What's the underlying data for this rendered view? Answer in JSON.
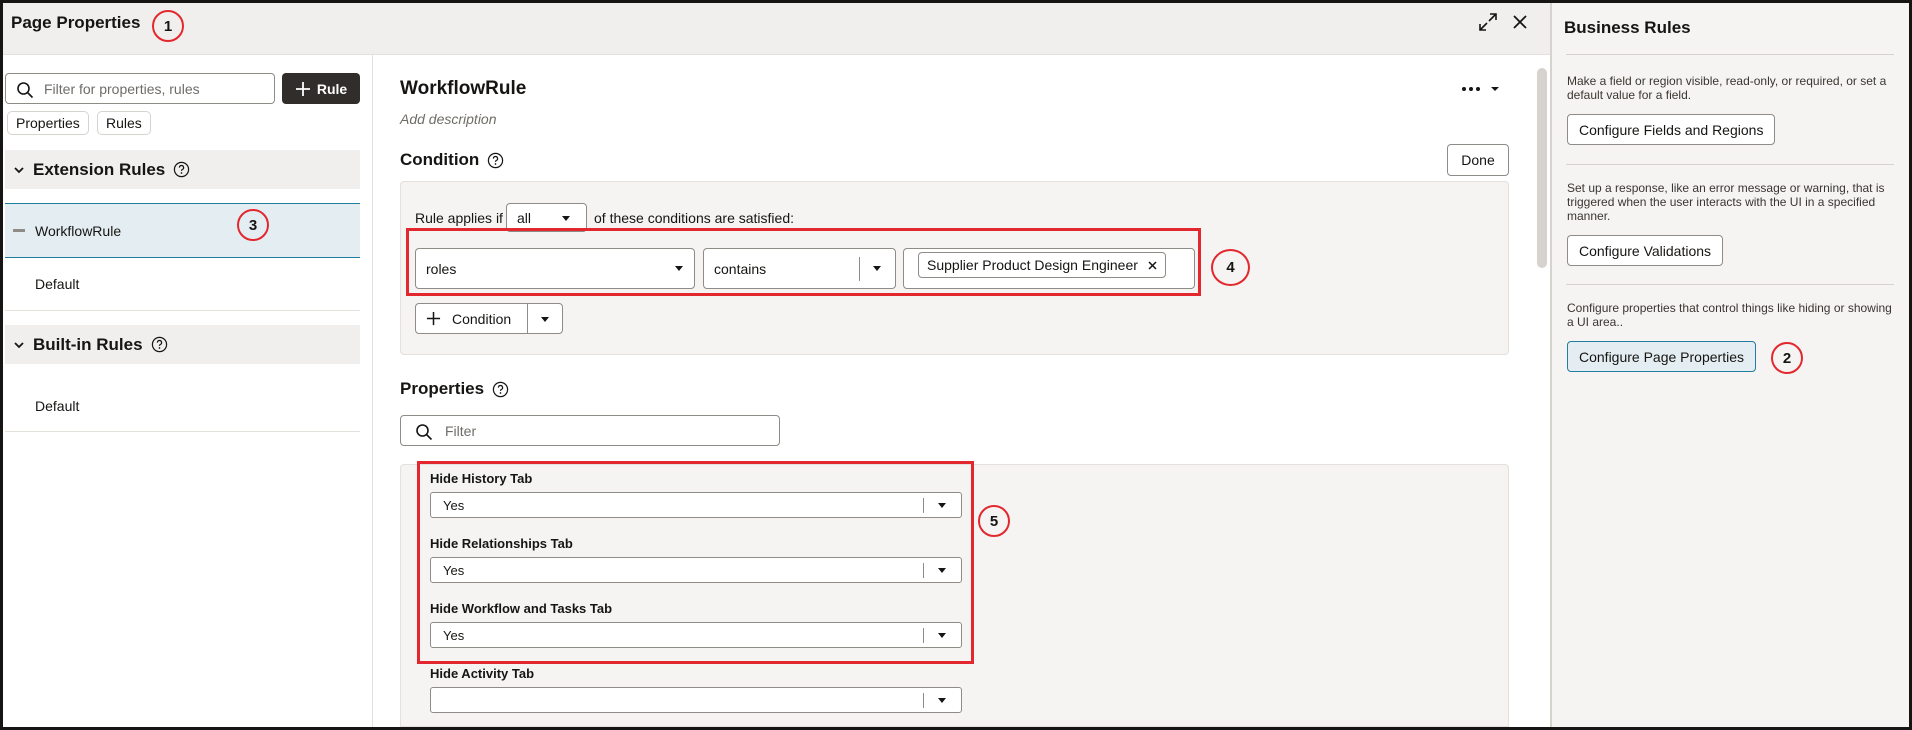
{
  "window": {
    "title": "Page Properties",
    "expand_icon": "expand-icon",
    "close_icon": "close-icon"
  },
  "left_panel": {
    "filter_placeholder": "Filter for properties, rules",
    "rule_button": "Rule",
    "chips": [
      "Properties",
      "Rules"
    ],
    "extension_rules": {
      "heading": "Extension Rules",
      "items": [
        "WorkflowRule",
        "Default"
      ]
    },
    "builtin_rules": {
      "heading": "Built-in Rules",
      "items": [
        "Default"
      ]
    }
  },
  "main": {
    "title": "WorkflowRule",
    "description_placeholder": "Add description",
    "condition": {
      "heading": "Condition",
      "done_button": "Done",
      "applies_prefix": "Rule applies if",
      "applies_value": "all",
      "applies_suffix": "of these conditions are satisfied:",
      "field": "roles",
      "operator": "contains",
      "value_token": "Supplier Product Design Engineer",
      "add_condition_button": "Condition"
    },
    "properties": {
      "heading": "Properties",
      "filter_placeholder": "Filter",
      "items": [
        {
          "label": "Hide History Tab",
          "value": "Yes"
        },
        {
          "label": "Hide Relationships Tab",
          "value": "Yes"
        },
        {
          "label": "Hide Workflow and Tasks Tab",
          "value": "Yes"
        },
        {
          "label": "Hide Activity Tab",
          "value": ""
        }
      ]
    }
  },
  "business_rules": {
    "title": "Business Rules",
    "sections": [
      {
        "description": "Make a field or region visible, read-only, or required, or set a default value for a field.",
        "button": "Configure Fields and Regions"
      },
      {
        "description": "Set up a response, like an error message or warning, that is triggered when the user interacts with the UI in a specified manner.",
        "button": "Configure Validations"
      },
      {
        "description": "Configure properties that control things like hiding or showing a UI area..",
        "button": "Configure Page Properties"
      }
    ]
  },
  "annotations": [
    "1",
    "2",
    "3",
    "4",
    "5"
  ],
  "colors": {
    "callout": "#e2282e",
    "accent": "#227e9e",
    "dark_button": "#312d2a"
  }
}
